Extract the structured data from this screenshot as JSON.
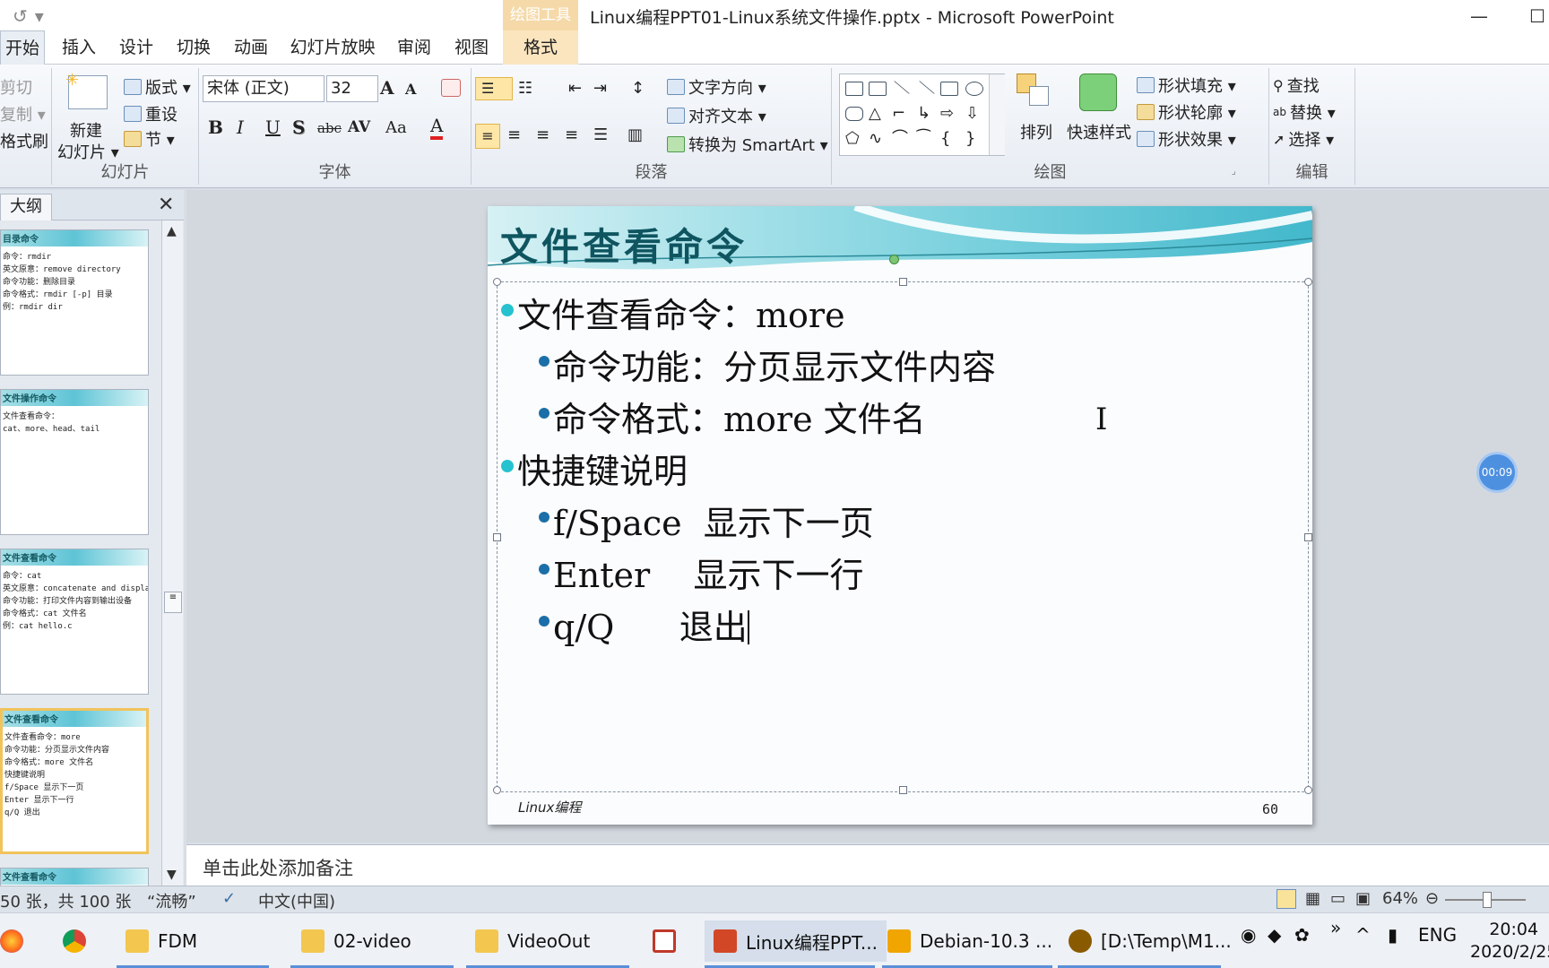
{
  "window": {
    "title": "Linux编程PPT01-Linux系统文件操作.pptx - Microsoft PowerPoint",
    "context_group": "绘图工具",
    "buttons": {
      "minimize": "—",
      "maximize": "☐"
    }
  },
  "quick_access": {
    "redo_icon": "↺",
    "more": "▾"
  },
  "tabs": [
    "开始",
    "插入",
    "设计",
    "切换",
    "动画",
    "幻灯片放映",
    "审阅",
    "视图",
    "格式"
  ],
  "ribbon": {
    "clipboard": {
      "cut": "剪切",
      "copy": "复制 ▾",
      "format_painter": "格式刷"
    },
    "slides": {
      "new_slide_1": "新建",
      "new_slide_2": "幻灯片 ▾",
      "layout": "版式 ▾",
      "reset": "重设",
      "section": "节 ▾",
      "label": "幻灯片"
    },
    "font": {
      "name": "宋体 (正文)",
      "size": "32",
      "label": "字体",
      "bold": "B",
      "italic": "I",
      "underline": "U",
      "shadow": "S",
      "strike": "abc",
      "spacing": "AV",
      "case": "Aa",
      "color": "A",
      "grow": "A",
      "shrink": "A"
    },
    "paragraph": {
      "text_direction": "文字方向 ▾",
      "align_text": "对齐文本 ▾",
      "smartart": "转换为 SmartArt ▾",
      "label": "段落"
    },
    "drawing": {
      "arrange": "排列",
      "quick_styles": "快速样式",
      "fill": "形状填充 ▾",
      "outline": "形状轮廓 ▾",
      "effects": "形状效果 ▾",
      "label": "绘图"
    },
    "editing": {
      "find": "查找",
      "replace": "替换 ▾",
      "select": "选择 ▾",
      "label": "编辑"
    }
  },
  "slides_pane": {
    "tab": "大纲",
    "close": "✕",
    "thumbnails": [
      {
        "title": "目录命令",
        "lines": [
          "命令：rmdir",
          "英文原意：remove directory",
          "命令功能：删除目录",
          "命令格式：rmdir [-p] 目录",
          "例：rmdir dir"
        ]
      },
      {
        "title": "文件操作命令",
        "lines": [
          "文件查看命令：",
          "cat、more、head、tail"
        ]
      },
      {
        "title": "文件查看命令",
        "lines": [
          "命令：cat",
          "英文原意：concatenate and display files",
          "命令功能：打印文件内容到输出设备",
          "命令格式：cat 文件名",
          "例：cat hello.c"
        ]
      },
      {
        "title": "文件查看命令",
        "lines": [
          "文件查看命令：more",
          "命令功能：分页显示文件内容",
          "命令格式：more 文件名",
          "快捷键说明",
          "f/Space  显示下一页",
          "Enter    显示下一行",
          "q/Q      退出"
        ]
      },
      {
        "title": "文件查看命令",
        "lines": []
      }
    ]
  },
  "slide": {
    "title": "文件查看命令",
    "bullets": [
      {
        "level": 1,
        "text": "文件查看命令：more"
      },
      {
        "level": 2,
        "text": "命令功能：分页显示文件内容"
      },
      {
        "level": 2,
        "text": "命令格式：more 文件名"
      },
      {
        "level": 1,
        "text": "快捷键说明"
      },
      {
        "level": 2,
        "text": "f/Space  显示下一页"
      },
      {
        "level": 2,
        "text": "Enter    显示下一行"
      },
      {
        "level": 2,
        "text": "q/Q      退出"
      }
    ],
    "footer_left": "Linux编程",
    "page_number": "60"
  },
  "timer_badge": "00:09",
  "notes_placeholder": "单击此处添加备注",
  "status_bar": {
    "slide_info": "50 张，共 100 张",
    "theme": "“流畅”",
    "language": "中文(中国)",
    "zoom": "64%"
  },
  "taskbar": {
    "items": [
      "FDM",
      "02-video",
      "VideoOut",
      "Linux编程PPT...",
      "Debian-10.3 ...",
      "[D:\\Temp\\M1..."
    ],
    "tray_lang": "ENG",
    "time": "20:04",
    "date": "2020/2/25"
  },
  "colors": {
    "accent_teal": "#27c2cf",
    "title_teal": "#0f5560",
    "context_tab": "#f5d9a8",
    "timer_blue": "#4e90e0"
  }
}
